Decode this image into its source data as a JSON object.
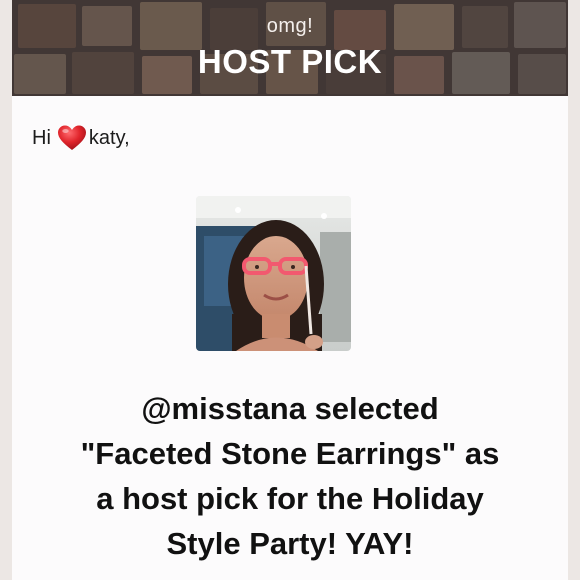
{
  "banner": {
    "subtitle": "omg!",
    "title": "HOST PICK"
  },
  "greeting": {
    "hi": "Hi",
    "name": "katy,",
    "heart_icon": "heart-icon"
  },
  "avatar": {
    "icon": "host-profile-photo"
  },
  "message": {
    "lines": [
      "@misstana selected",
      "\"Faceted Stone Earrings\" as",
      "a host pick for the Holiday",
      "Style Party! YAY!"
    ]
  },
  "colors": {
    "heart": "#e0242b",
    "text": "#111111",
    "card": "#fcfbfc"
  }
}
